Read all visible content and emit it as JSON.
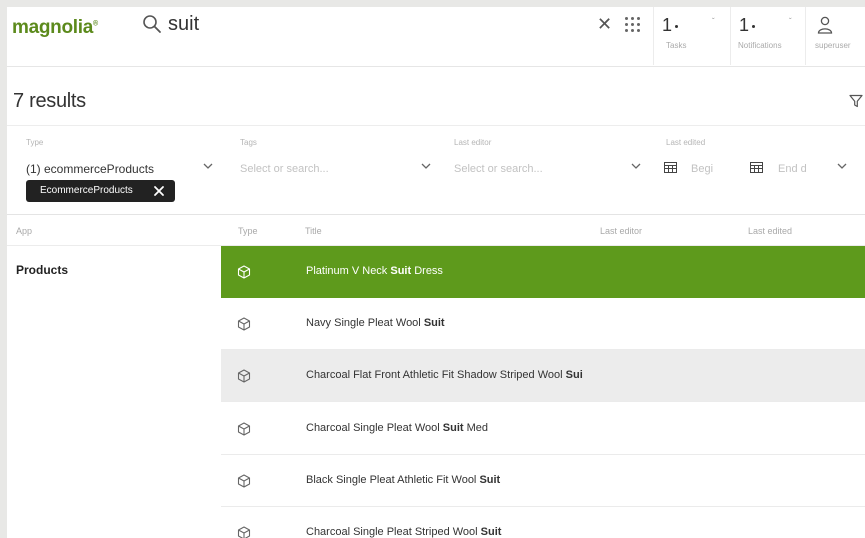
{
  "brand": {
    "logo_text": "magnolia",
    "logo_mark": "®",
    "accent_color": "#5e9a1c"
  },
  "search": {
    "value": "suit",
    "placeholder": ""
  },
  "header": {
    "tasks": {
      "count": "1",
      "label": "Tasks"
    },
    "notifications": {
      "count": "1",
      "label": "Notifications"
    },
    "user": {
      "label": "superuser"
    }
  },
  "results": {
    "title": "7 results"
  },
  "filters": {
    "type": {
      "label": "Type",
      "value": "(1) ecommerceProducts"
    },
    "tags": {
      "label": "Tags",
      "placeholder": "Select or search..."
    },
    "last_editor": {
      "label": "Last editor",
      "placeholder": "Select or search..."
    },
    "last_edited": {
      "label": "Last edited",
      "begin_placeholder": "Begi",
      "end_placeholder": "End d"
    },
    "chip": {
      "label": "EcommerceProducts"
    }
  },
  "table": {
    "columns": {
      "app": "App",
      "type": "Type",
      "title": "Title",
      "last_editor": "Last editor",
      "last_edited": "Last edited"
    },
    "app_label": "Products",
    "rows": [
      {
        "title_pre": "Platinum V Neck ",
        "title_match": "Suit",
        "title_post": " Dress",
        "icon": "cube-icon",
        "state": "selected"
      },
      {
        "title_pre": "Navy Single Pleat Wool ",
        "title_match": "Suit",
        "title_post": "",
        "icon": "cube-icon",
        "state": ""
      },
      {
        "title_pre": "Charcoal Flat Front Athletic Fit Shadow Striped Wool ",
        "title_match": "Sui",
        "title_post": "",
        "icon": "cube-icon",
        "state": "hover"
      },
      {
        "title_pre": "Charcoal Single Pleat Wool ",
        "title_match": "Suit",
        "title_post": " Med",
        "icon": "cube-icon",
        "state": ""
      },
      {
        "title_pre": "Black Single Pleat Athletic Fit Wool ",
        "title_match": "Suit",
        "title_post": "",
        "icon": "cube-icon",
        "state": ""
      },
      {
        "title_pre": "Charcoal Single Pleat Striped Wool ",
        "title_match": "Suit",
        "title_post": "",
        "icon": "cube-icon",
        "state": ""
      }
    ]
  }
}
